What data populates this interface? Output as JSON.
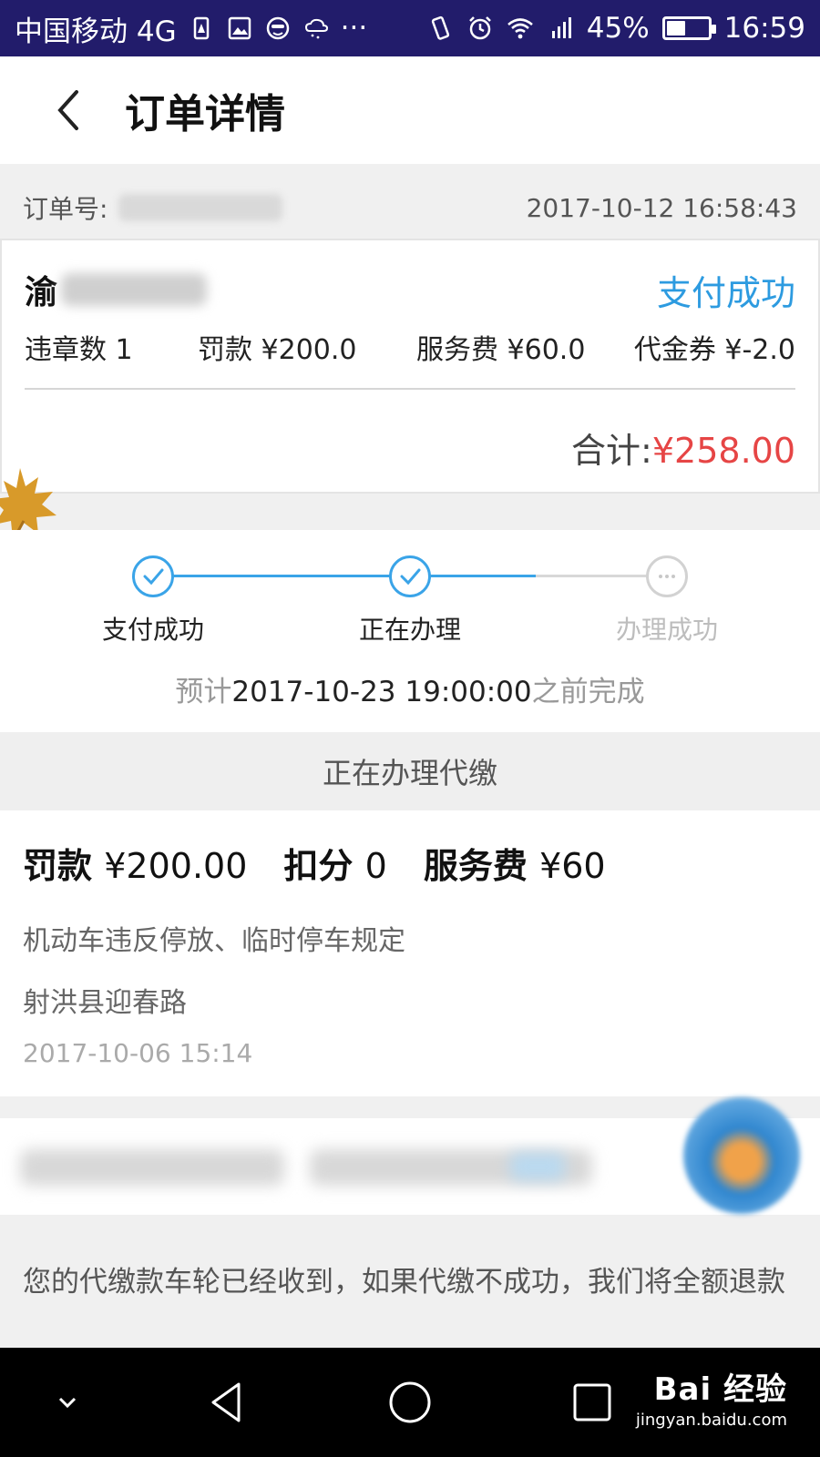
{
  "status_bar": {
    "carrier": "中国移动 4G",
    "more": "···",
    "battery_pct": "45%",
    "battery_level": 0.45,
    "time": "16:59"
  },
  "header": {
    "title": "订单详情",
    "back_icon": "chevron-left-icon"
  },
  "order": {
    "order_no_label": "订单号:",
    "created_at": "2017-10-12 16:58:43",
    "plate_prefix": "渝",
    "pay_status": "支付成功",
    "violations": "违章数 1",
    "fine": "罚款 ¥200.0",
    "service_fee": "服务费 ¥60.0",
    "coupon": "代金券 ¥-2.0",
    "total_label": "合计:",
    "total_value": "¥258.00"
  },
  "progress": {
    "steps": [
      {
        "label": "支付成功",
        "state": "done"
      },
      {
        "label": "正在办理",
        "state": "done"
      },
      {
        "label": "办理成功",
        "state": "pending"
      }
    ],
    "eta_prefix": "预计",
    "eta_date": "2017-10-23 19:00:00",
    "eta_suffix": "之前完成"
  },
  "processing_banner": "正在办理代缴",
  "violation": {
    "fine_label": "罚款",
    "fine_value": "¥200.00",
    "points_label": "扣分",
    "points_value": "0",
    "service_label": "服务费",
    "service_value": "¥60",
    "reason": "机动车违反停放、临时停车规定",
    "place": "射洪县迎春路",
    "time": "2017-10-06 15:14"
  },
  "notice": "您的代缴款车轮已经收到，如果代缴不成功，我们将全额退款",
  "watermark": {
    "logo": "Bai 经验",
    "url": "jingyan.baidu.com"
  },
  "colors": {
    "status_bar_bg": "#221c6b",
    "accent_blue": "#2d9be0",
    "step_blue": "#3aa4e8",
    "total_red": "#e64545"
  }
}
